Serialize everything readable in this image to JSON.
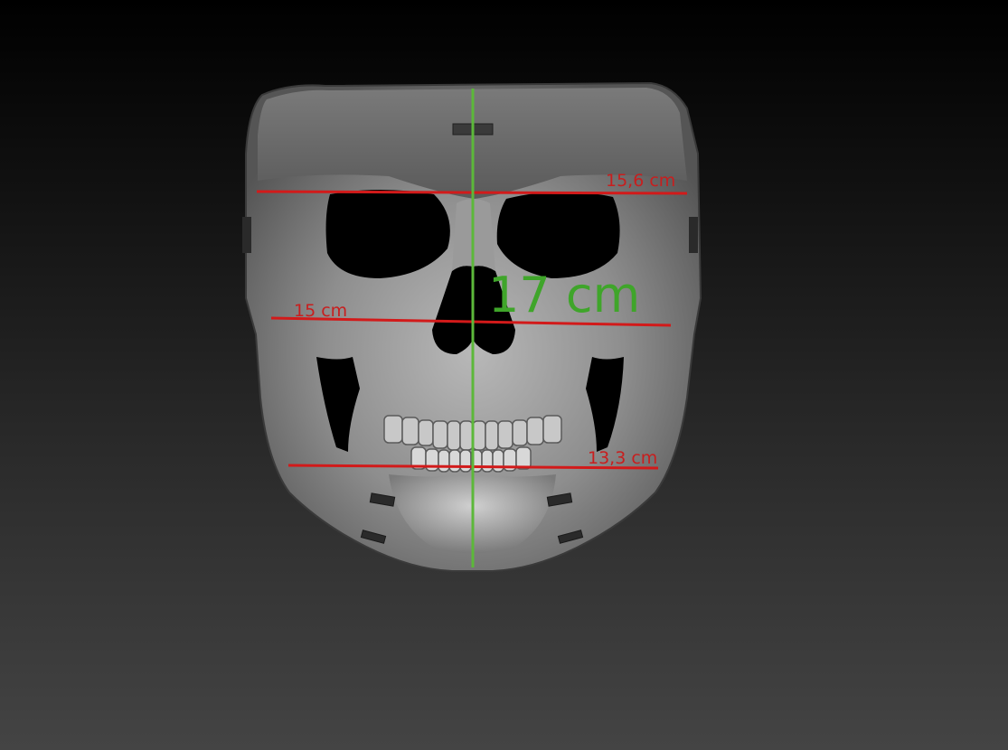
{
  "measurements": {
    "brow_width": "15,6 cm",
    "cheek_width": "15 cm",
    "jaw_width": "13,3 cm",
    "face_height": "17 cm"
  },
  "colors": {
    "horizontal_line": "#d21a1a",
    "vertical_line": "#5cb83a",
    "height_label": "#3fa52a",
    "width_label": "#c81e1e"
  }
}
